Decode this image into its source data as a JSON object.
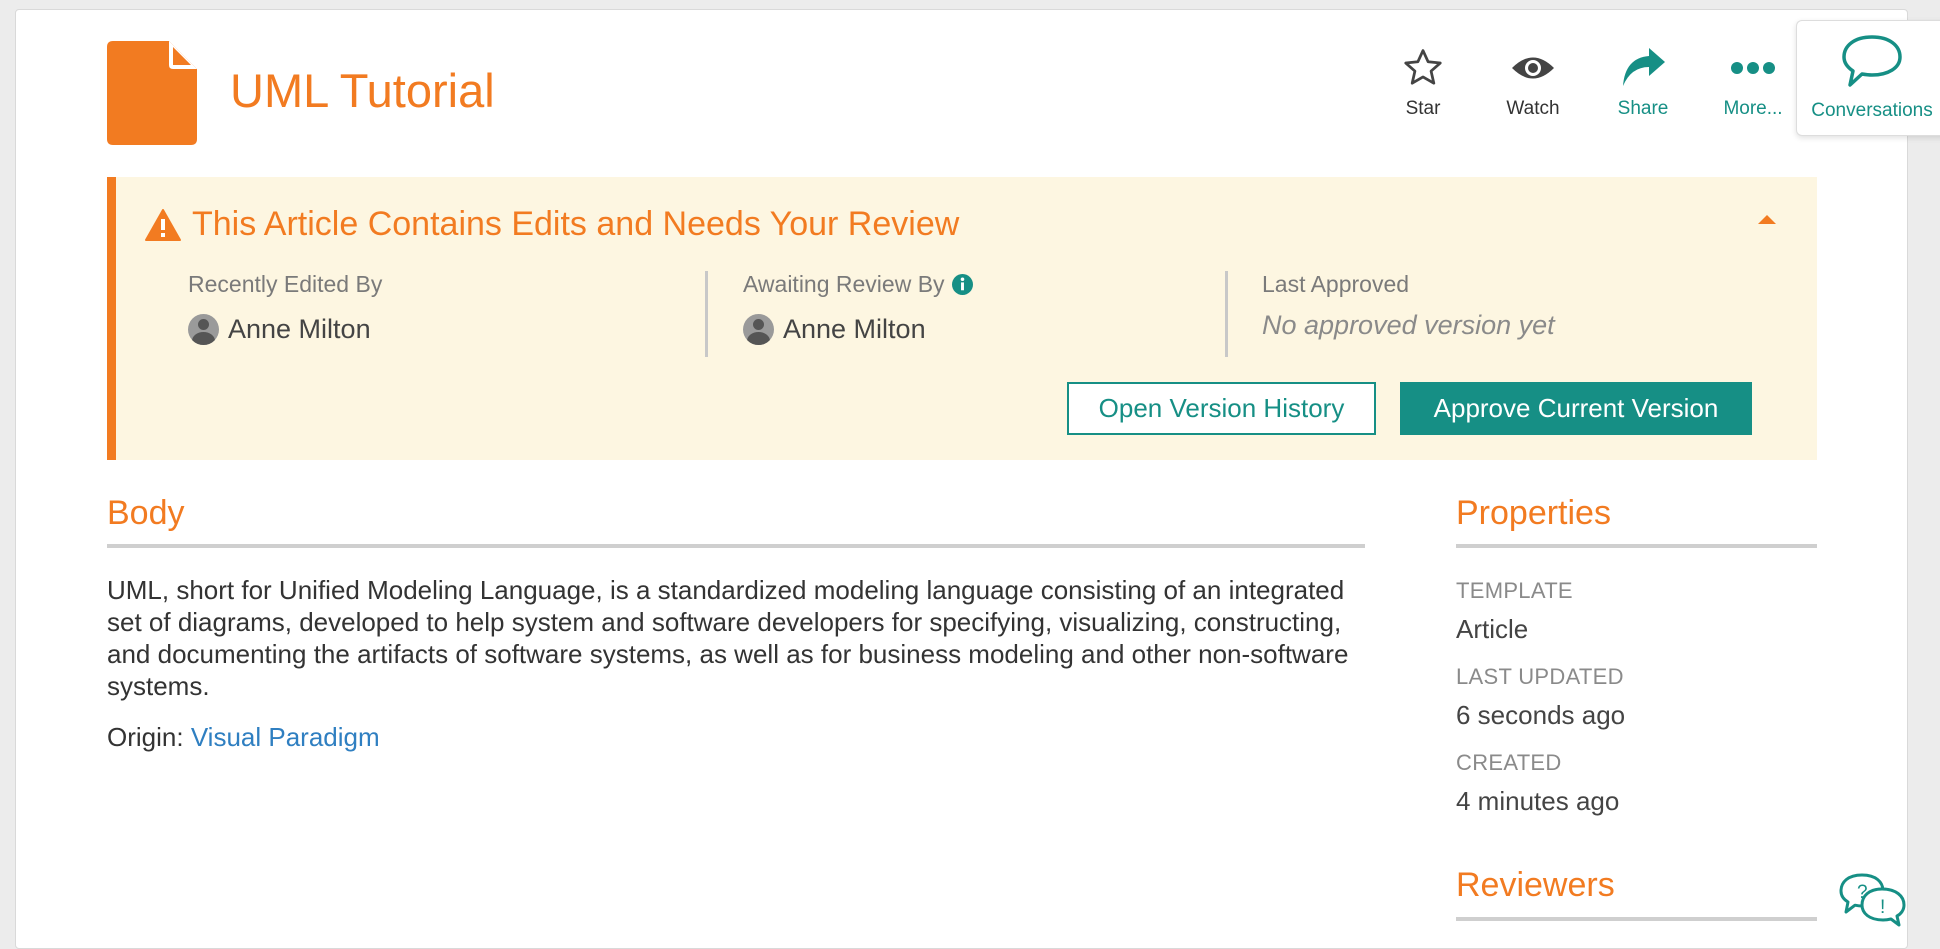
{
  "header": {
    "title": "UML Tutorial",
    "actions": [
      {
        "icon": "star-icon",
        "label": "Star"
      },
      {
        "icon": "eye-icon",
        "label": "Watch"
      },
      {
        "icon": "share-icon",
        "label": "Share"
      },
      {
        "icon": "more-icon",
        "label": "More..."
      }
    ],
    "conversations_label": "Conversations"
  },
  "review_alert": {
    "title": "This Article Contains Edits and Needs Your Review",
    "recently_edited_label": "Recently Edited By",
    "recently_edited_user": "Anne Milton",
    "awaiting_review_label": "Awaiting Review By",
    "awaiting_review_user": "Anne Milton",
    "last_approved_label": "Last Approved",
    "last_approved_value": "No approved version yet",
    "open_history_label": "Open Version History",
    "approve_label": "Approve Current Version"
  },
  "body": {
    "heading": "Body",
    "text": "UML, short for Unified Modeling Language, is a standardized modeling language consisting of an integrated set of diagrams, developed to help system and software developers for specifying, visualizing, constructing, and documenting the artifacts of software systems, as well as for business modeling and other non-software systems.",
    "origin_label": "Origin:",
    "origin_link": "Visual Paradigm"
  },
  "properties": {
    "heading": "Properties",
    "template_label": "TEMPLATE",
    "template_value": "Article",
    "last_updated_label": "LAST UPDATED",
    "last_updated_value": "6 seconds ago",
    "created_label": "CREATED",
    "created_value": "4 minutes ago"
  },
  "reviewers": {
    "heading": "Reviewers"
  },
  "colors": {
    "accent_orange": "#f27b21",
    "teal": "#168f85",
    "alert_bg": "#fdf6e1",
    "link_blue": "#2f7fc1"
  }
}
